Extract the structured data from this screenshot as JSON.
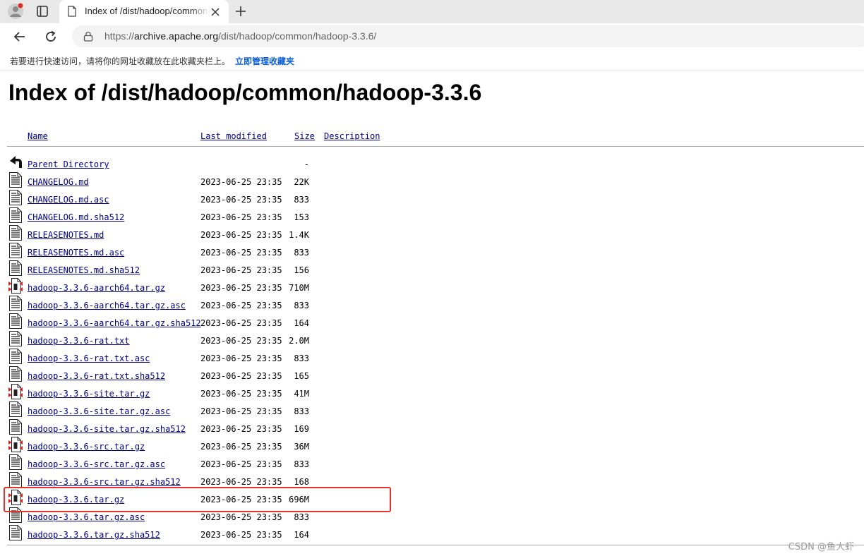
{
  "browser": {
    "tab_title": "Index of /dist/hadoop/common/hadoop-3.3.6",
    "url_prefix": "https://",
    "url_host": "archive.apache.org",
    "url_path": "/dist/hadoop/common/hadoop-3.3.6/",
    "bookmark_hint": "若要进行快速访问，请将你的网址收藏放在此收藏夹栏上。",
    "bookmark_link": "立即管理收藏夹"
  },
  "page": {
    "title": "Index of /dist/hadoop/common/hadoop-3.3.6",
    "columns": {
      "name": "Name",
      "last_modified": "Last modified",
      "size": "Size",
      "description": "Description"
    },
    "entries": [
      {
        "name": "Parent Directory",
        "date": "",
        "size": "-",
        "icon": "back-icon"
      },
      {
        "name": "CHANGELOG.md",
        "date": "2023-06-25 23:35",
        "size": "22K",
        "icon": "text-file-icon"
      },
      {
        "name": "CHANGELOG.md.asc",
        "date": "2023-06-25 23:35",
        "size": "833",
        "icon": "text-file-icon"
      },
      {
        "name": "CHANGELOG.md.sha512",
        "date": "2023-06-25 23:35",
        "size": "153",
        "icon": "text-file-icon"
      },
      {
        "name": "RELEASENOTES.md",
        "date": "2023-06-25 23:35",
        "size": "1.4K",
        "icon": "text-file-icon"
      },
      {
        "name": "RELEASENOTES.md.asc",
        "date": "2023-06-25 23:35",
        "size": "833",
        "icon": "text-file-icon"
      },
      {
        "name": "RELEASENOTES.md.sha512",
        "date": "2023-06-25 23:35",
        "size": "156",
        "icon": "text-file-icon"
      },
      {
        "name": "hadoop-3.3.6-aarch64.tar.gz",
        "date": "2023-06-25 23:35",
        "size": "710M",
        "icon": "archive-file-icon"
      },
      {
        "name": "hadoop-3.3.6-aarch64.tar.gz.asc",
        "date": "2023-06-25 23:35",
        "size": "833",
        "icon": "text-file-icon"
      },
      {
        "name": "hadoop-3.3.6-aarch64.tar.gz.sha512",
        "date": "2023-06-25 23:35",
        "size": "164",
        "icon": "text-file-icon"
      },
      {
        "name": "hadoop-3.3.6-rat.txt",
        "date": "2023-06-25 23:35",
        "size": "2.0M",
        "icon": "text-file-icon"
      },
      {
        "name": "hadoop-3.3.6-rat.txt.asc",
        "date": "2023-06-25 23:35",
        "size": "833",
        "icon": "text-file-icon"
      },
      {
        "name": "hadoop-3.3.6-rat.txt.sha512",
        "date": "2023-06-25 23:35",
        "size": "165",
        "icon": "text-file-icon"
      },
      {
        "name": "hadoop-3.3.6-site.tar.gz",
        "date": "2023-06-25 23:35",
        "size": "41M",
        "icon": "archive-file-icon"
      },
      {
        "name": "hadoop-3.3.6-site.tar.gz.asc",
        "date": "2023-06-25 23:35",
        "size": "833",
        "icon": "text-file-icon"
      },
      {
        "name": "hadoop-3.3.6-site.tar.gz.sha512",
        "date": "2023-06-25 23:35",
        "size": "169",
        "icon": "text-file-icon"
      },
      {
        "name": "hadoop-3.3.6-src.tar.gz",
        "date": "2023-06-25 23:35",
        "size": "36M",
        "icon": "archive-file-icon"
      },
      {
        "name": "hadoop-3.3.6-src.tar.gz.asc",
        "date": "2023-06-25 23:35",
        "size": "833",
        "icon": "text-file-icon"
      },
      {
        "name": "hadoop-3.3.6-src.tar.gz.sha512",
        "date": "2023-06-25 23:35",
        "size": "168",
        "icon": "text-file-icon"
      },
      {
        "name": "hadoop-3.3.6.tar.gz",
        "date": "2023-06-25 23:35",
        "size": "696M",
        "icon": "archive-file-icon",
        "highlighted": true
      },
      {
        "name": "hadoop-3.3.6.tar.gz.asc",
        "date": "2023-06-25 23:35",
        "size": "833",
        "icon": "text-file-icon"
      },
      {
        "name": "hadoop-3.3.6.tar.gz.sha512",
        "date": "2023-06-25 23:35",
        "size": "164",
        "icon": "text-file-icon"
      }
    ]
  },
  "watermark": "CSDN @鱼大虾",
  "colors": {
    "link": "#00008b",
    "highlight_border": "#e5322d",
    "chrome_bg": "#e8e8e8"
  }
}
